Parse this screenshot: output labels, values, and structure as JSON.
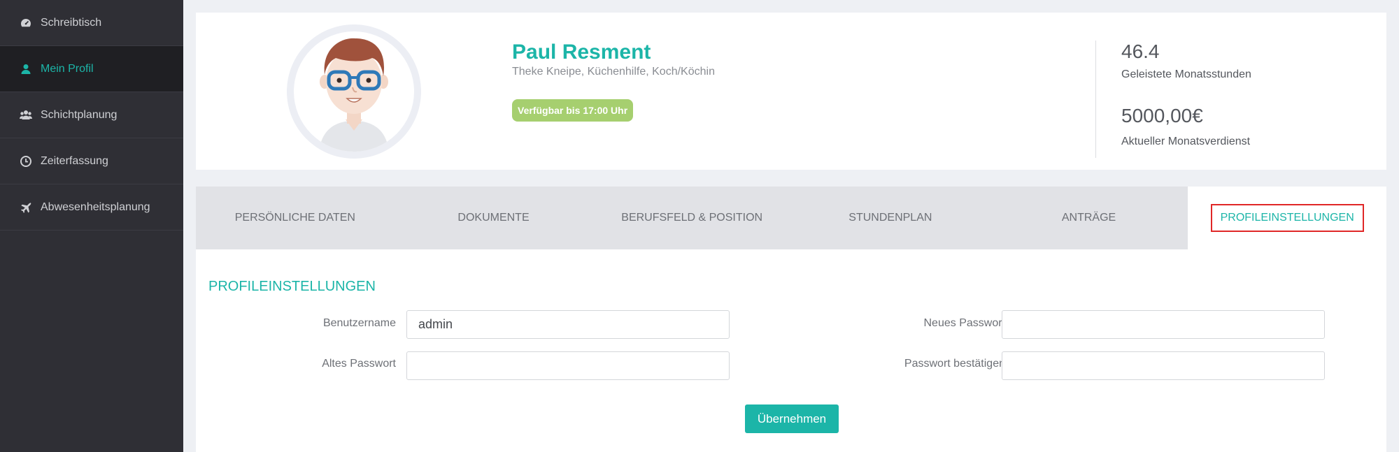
{
  "sidebar": {
    "items": [
      {
        "label": "Schreibtisch",
        "icon": "dashboard-icon"
      },
      {
        "label": "Mein Profil",
        "icon": "user-icon"
      },
      {
        "label": "Schichtplanung",
        "icon": "users-icon"
      },
      {
        "label": "Zeiterfassung",
        "icon": "clock-icon"
      },
      {
        "label": "Abwesenheitsplanung",
        "icon": "plane-icon"
      }
    ]
  },
  "profile": {
    "name": "Paul Resment",
    "roles": "Theke Kneipe, Küchenhilfe, Koch/Köchin",
    "availability": "Verfügbar bis 17:00 Uhr"
  },
  "stats": {
    "hours_value": "46.4",
    "hours_label": "Geleistete Monatsstunden",
    "earnings_value": "5000,00€",
    "earnings_label": "Aktueller Monatsverdienst"
  },
  "tabs": [
    {
      "label": "PERSÖNLICHE DATEN"
    },
    {
      "label": "DOKUMENTE"
    },
    {
      "label": "BERUFSFELD & POSITION"
    },
    {
      "label": "STUNDENPLAN"
    },
    {
      "label": "ANTRÄGE"
    },
    {
      "label": "PROFILEINSTELLUNGEN"
    }
  ],
  "settings": {
    "title": "PROFILEINSTELLUNGEN",
    "username_label": "Benutzername",
    "username_value": "admin",
    "old_password_label": "Altes Passwort",
    "new_password_label": "Neues Passwort",
    "confirm_password_label": "Passwort bestätigen",
    "submit_label": "Übernehmen"
  },
  "colors": {
    "accent": "#1cb5a8",
    "sidebar_bg": "#2f2f35",
    "badge_bg": "#a6cf6f",
    "highlight_border": "#e02727"
  }
}
